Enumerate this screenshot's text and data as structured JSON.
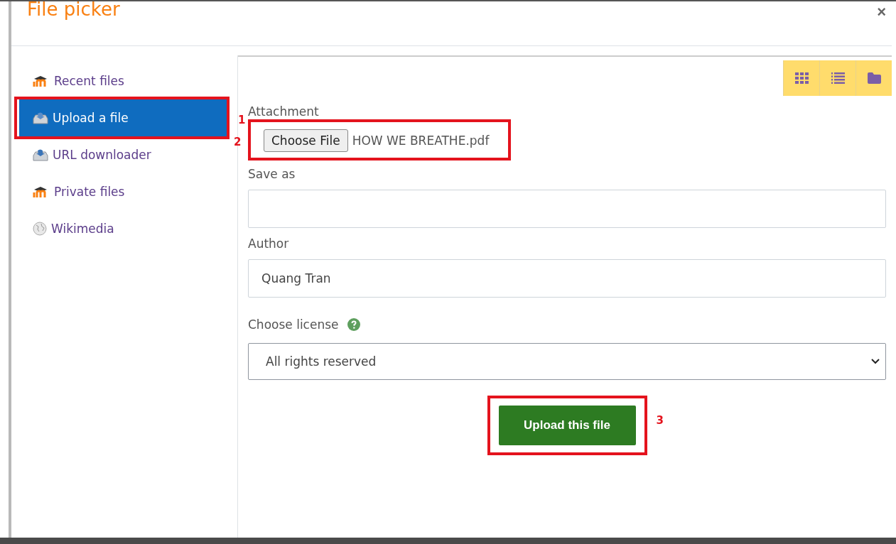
{
  "dialog": {
    "title": "File picker",
    "close": "×"
  },
  "sidebar": {
    "items": [
      {
        "label": "Recent files",
        "kind": "moodle",
        "selected": false
      },
      {
        "label": "Upload a file",
        "kind": "upload",
        "selected": true,
        "annotation": "1"
      },
      {
        "label": "URL downloader",
        "kind": "download",
        "selected": false
      },
      {
        "label": "Private files",
        "kind": "moodle",
        "selected": false
      },
      {
        "label": "Wikimedia",
        "kind": "globe",
        "selected": false
      }
    ]
  },
  "view_buttons": [
    {
      "kind": "grid",
      "selected": false
    },
    {
      "kind": "list",
      "selected": false
    },
    {
      "kind": "folder",
      "selected": false
    }
  ],
  "form": {
    "attachment": {
      "label": "Attachment",
      "button": "Choose File",
      "file": "HOW WE BREATHE.pdf",
      "annotation": "2"
    },
    "save_as": {
      "label": "Save as"
    },
    "author": {
      "label": "Author",
      "value": "Quang Tran"
    },
    "license": {
      "label": "Choose license",
      "value": "All rights reserved"
    },
    "submit": {
      "label": "Upload this file",
      "annotation": "3"
    }
  }
}
